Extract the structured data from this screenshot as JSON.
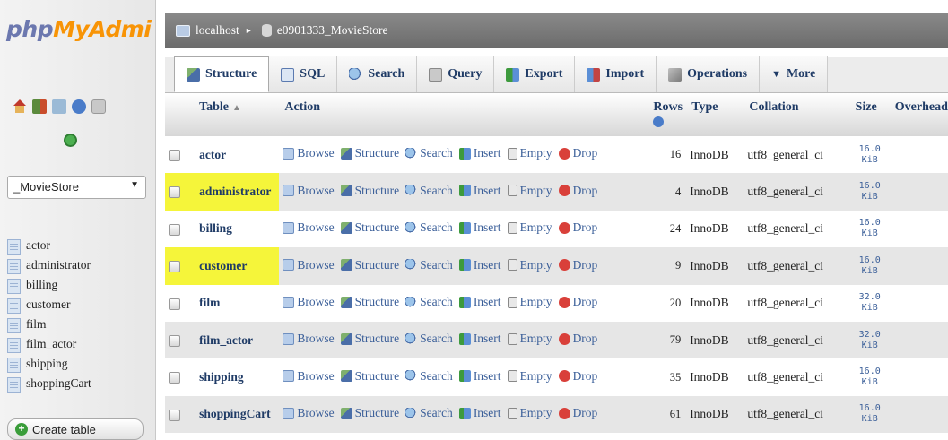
{
  "app": {
    "logo_php": "php",
    "logo_rest": "MyAdmi"
  },
  "nav": {
    "db_selected": "_MovieStore",
    "tables": [
      "actor",
      "administrator",
      "billing",
      "customer",
      "film",
      "film_actor",
      "shipping",
      "shoppingCart"
    ],
    "create_table_label": "Create table",
    "icons": [
      "home-icon",
      "exit-icon",
      "docs-icon",
      "help-icon",
      "settings-icon",
      "reload-icon"
    ]
  },
  "breadcrumb": {
    "server": "localhost",
    "database": "e0901333_MovieStore"
  },
  "tabs": [
    {
      "label": "Structure",
      "icon": "structure-icon",
      "active": true
    },
    {
      "label": "SQL",
      "icon": "sql-icon"
    },
    {
      "label": "Search",
      "icon": "search-icon"
    },
    {
      "label": "Query",
      "icon": "query-icon"
    },
    {
      "label": "Export",
      "icon": "export-icon"
    },
    {
      "label": "Import",
      "icon": "import-icon"
    },
    {
      "label": "Operations",
      "icon": "operations-icon"
    },
    {
      "label": "More",
      "icon": "more-caret-icon"
    }
  ],
  "table": {
    "headers": {
      "table": "Table",
      "action": "Action",
      "rows": "Rows",
      "type": "Type",
      "collation": "Collation",
      "size": "Size",
      "overhead": "Overhead"
    },
    "actions": [
      "Browse",
      "Structure",
      "Search",
      "Insert",
      "Empty",
      "Drop"
    ],
    "rows": [
      {
        "name": "actor",
        "rows": "16",
        "type": "InnoDB",
        "collation": "utf8_general_ci",
        "size_value": "16.0",
        "size_unit": "KiB",
        "overhead": "-",
        "highlighted": false
      },
      {
        "name": "administrator",
        "rows": "4",
        "type": "InnoDB",
        "collation": "utf8_general_ci",
        "size_value": "16.0",
        "size_unit": "KiB",
        "overhead": "-",
        "highlighted": true
      },
      {
        "name": "billing",
        "rows": "24",
        "type": "InnoDB",
        "collation": "utf8_general_ci",
        "size_value": "16.0",
        "size_unit": "KiB",
        "overhead": "-",
        "highlighted": false
      },
      {
        "name": "customer",
        "rows": "9",
        "type": "InnoDB",
        "collation": "utf8_general_ci",
        "size_value": "16.0",
        "size_unit": "KiB",
        "overhead": "-",
        "highlighted": true
      },
      {
        "name": "film",
        "rows": "20",
        "type": "InnoDB",
        "collation": "utf8_general_ci",
        "size_value": "32.0",
        "size_unit": "KiB",
        "overhead": "-",
        "highlighted": false
      },
      {
        "name": "film_actor",
        "rows": "79",
        "type": "InnoDB",
        "collation": "utf8_general_ci",
        "size_value": "32.0",
        "size_unit": "KiB",
        "overhead": "-",
        "highlighted": false
      },
      {
        "name": "shipping",
        "rows": "35",
        "type": "InnoDB",
        "collation": "utf8_general_ci",
        "size_value": "16.0",
        "size_unit": "KiB",
        "overhead": "-",
        "highlighted": false
      },
      {
        "name": "shoppingCart",
        "rows": "61",
        "type": "InnoDB",
        "collation": "utf8_general_ci",
        "size_value": "16.0",
        "size_unit": "KiB",
        "overhead": "-",
        "highlighted": false
      }
    ]
  },
  "colors": {
    "highlight": "#f5f53a",
    "link": "#1f3b66",
    "breadcrumb_bg": "#7a7a7a"
  }
}
